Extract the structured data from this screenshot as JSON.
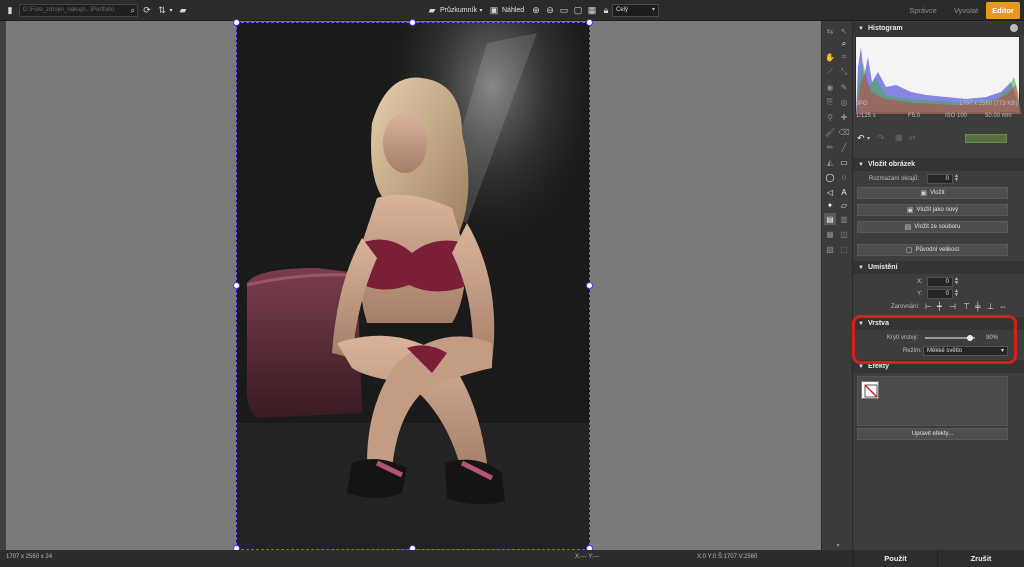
{
  "topbar": {
    "path_text": "D:\\Foto_zdroje\\_nakup\\...\\Portfolio",
    "explorer_label": "Průzkumník",
    "preview_label": "Náhled",
    "zoom_select": "Celý",
    "tabs": [
      "Správce",
      "Vyvolat",
      "Editor"
    ],
    "active_tab": "Editor",
    "accent_color": "#e59a1a"
  },
  "histogram": {
    "title": "Histogram",
    "format": "JPG",
    "dimensions": "1707 x 2560 (773 KB)",
    "shutter": "1/125 s",
    "aperture": "F5.0",
    "iso": "ISO 100",
    "focal": "50.00 mm"
  },
  "insert_image": {
    "title": "Vložit obrázek",
    "blur_label": "Rozmazání okrajů:",
    "blur_value": "0",
    "insert_btn": "Vložit",
    "insert_new_btn": "Vložit jako nový",
    "insert_file_btn": "Vložit ze souboru",
    "original_size_btn": "Původní velikost"
  },
  "placement": {
    "title": "Umístění",
    "x_label": "X:",
    "x_value": "0",
    "y_label": "Y:",
    "y_value": "0",
    "align_label": "Zarovnání:"
  },
  "layer": {
    "title": "Vrstva",
    "opacity_label": "Krytí vrstvy:",
    "opacity_value": "90%",
    "opacity_fraction": 0.9,
    "mode_label": "Režim:",
    "mode_value": "Měkké světlo",
    "highlight_color": "#d2201c"
  },
  "effects": {
    "title": "Efekty",
    "edit_btn": "Upravit efekty..."
  },
  "actions": {
    "apply": "Použít",
    "cancel": "Zrušit"
  },
  "status": {
    "image_info": "1707 x 2560 x 24",
    "cursor_xy": "X:--- Y:---",
    "selection": "X:0   Y:0   Š:1707   V:2560"
  }
}
